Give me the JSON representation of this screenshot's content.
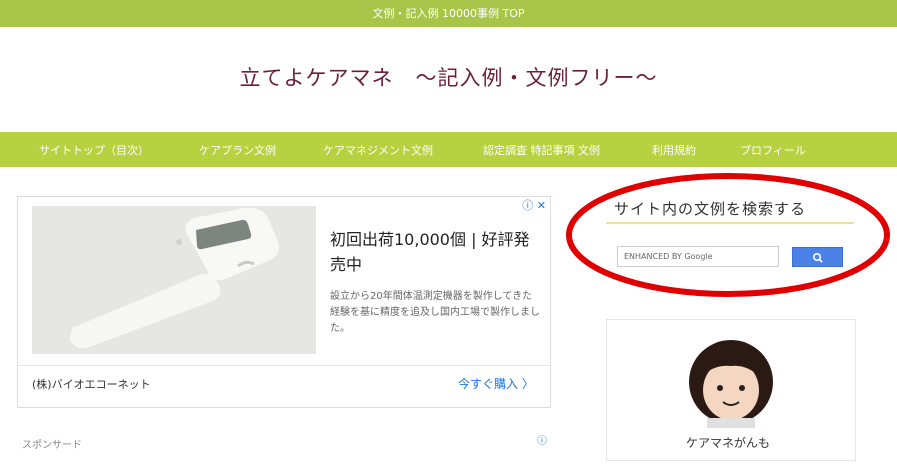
{
  "topbar": {
    "text": "文例・記入例 10000事例 TOP"
  },
  "site": {
    "title": "立てよケアマネ　～記入例・文例フリー～"
  },
  "nav": {
    "items": [
      {
        "label": "サイトトップ（目次）"
      },
      {
        "label": "ケアプラン文例"
      },
      {
        "label": "ケアマネジメント文例"
      },
      {
        "label": "認定調査 特記事項 文例"
      },
      {
        "label": "利用規約"
      },
      {
        "label": "プロフィール"
      }
    ]
  },
  "ad": {
    "headline": "初回出荷10,000個 | 好評発売中",
    "description": "設立から20年間体温測定機器を製作してきた経験を基に精度を追及し国内工場で製作しました。",
    "advertiser": "(株)バイオエコーネット",
    "cta": "今すぐ購入 〉",
    "choices_icon": "adchoices-icon",
    "close_icon": "close-icon"
  },
  "next_section": {
    "label": "スポンサード"
  },
  "sidebar": {
    "search_title": "サイト内の文例を検索する",
    "search_placeholder": "ENHANCED BY Google",
    "search_button_icon": "search-icon",
    "profile_name": "ケアマネがんも"
  },
  "colors": {
    "topbar": "#a8c54a",
    "navbar": "#b7d141",
    "title": "#6b1f3a",
    "highlight": "#e00000"
  }
}
